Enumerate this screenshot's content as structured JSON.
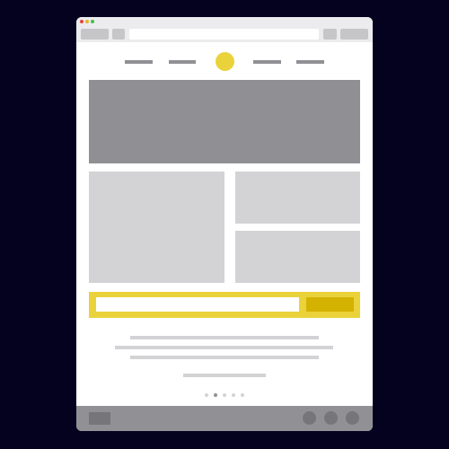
{
  "colors": {
    "page_background": "#05021f",
    "window": "#ffffff",
    "titlebar": "#ececee",
    "accent": "#ead23b",
    "accent_dark": "#d4b201",
    "placeholder_dark": "#8f8f94",
    "placeholder_light": "#d3d3d6",
    "footer": "#909095",
    "traffic_light_close": "#e8443a",
    "traffic_light_minimize": "#e8b42b",
    "traffic_light_maximize": "#3fbf4a"
  },
  "browser": {
    "url": "",
    "tabs": [
      "",
      ""
    ]
  },
  "header": {
    "nav_links": [
      "",
      "",
      "",
      ""
    ],
    "logo_icon": "circle-logo"
  },
  "subscribe": {
    "email_value": "",
    "email_placeholder": "",
    "submit_label": ""
  },
  "pagination": {
    "total": 5,
    "active_index": 1
  },
  "footer": {
    "social_icons": [
      "circle-icon",
      "circle-icon",
      "circle-icon"
    ]
  }
}
